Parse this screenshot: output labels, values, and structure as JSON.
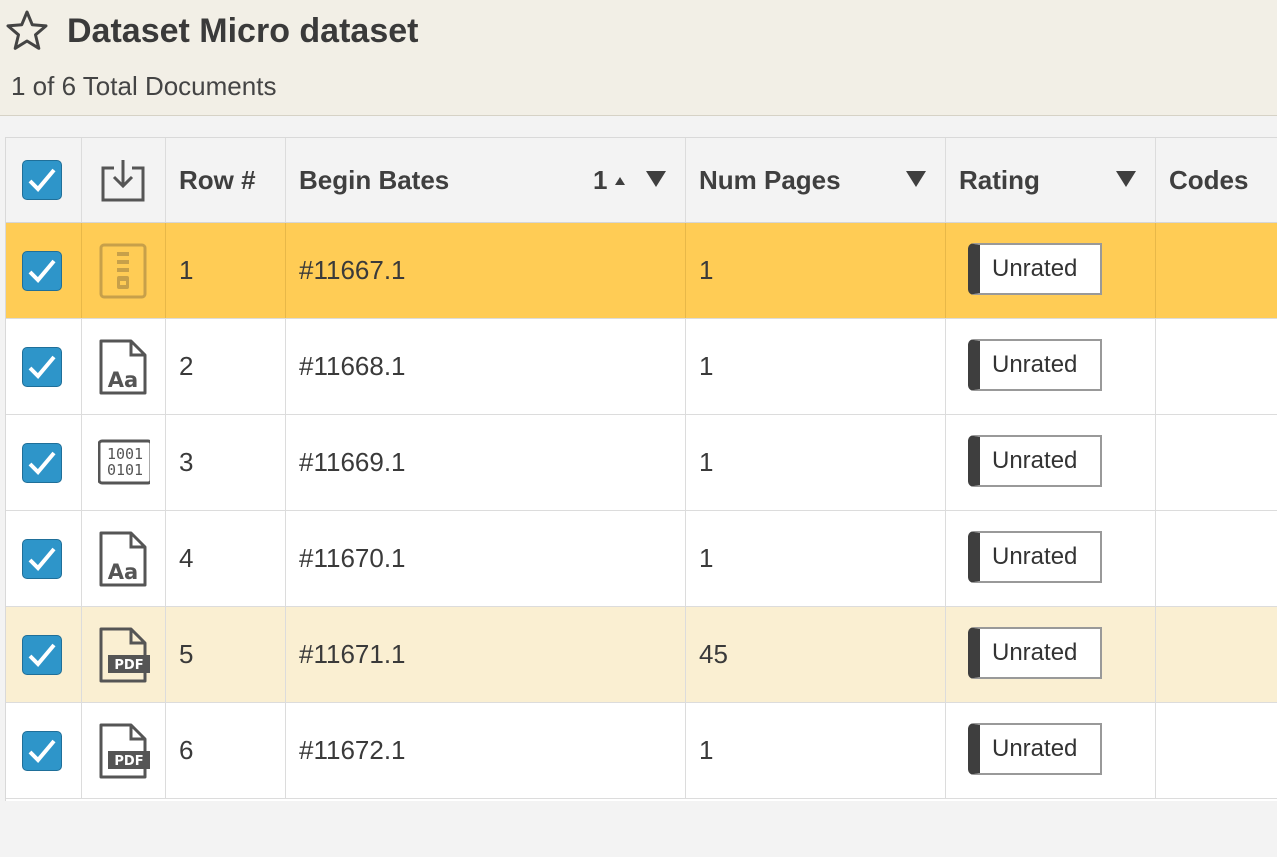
{
  "header": {
    "title": "Dataset Micro dataset",
    "subtitle": "1 of 6 Total Documents"
  },
  "columns": {
    "row_num": "Row #",
    "begin_bates": "Begin Bates",
    "begin_bates_sort": "1",
    "num_pages": "Num Pages",
    "rating": "Rating",
    "codes": "Codes"
  },
  "rows": [
    {
      "row": "1",
      "bates": "#11667.1",
      "pages": "1",
      "rating": "Unrated",
      "icon": "archive-file-icon"
    },
    {
      "row": "2",
      "bates": "#11668.1",
      "pages": "1",
      "rating": "Unrated",
      "icon": "text-document-icon"
    },
    {
      "row": "3",
      "bates": "#11669.1",
      "pages": "1",
      "rating": "Unrated",
      "icon": "binary-file-icon"
    },
    {
      "row": "4",
      "bates": "#11670.1",
      "pages": "1",
      "rating": "Unrated",
      "icon": "text-document-icon"
    },
    {
      "row": "5",
      "bates": "#11671.1",
      "pages": "45",
      "rating": "Unrated",
      "icon": "pdf-file-icon"
    },
    {
      "row": "6",
      "bates": "#11672.1",
      "pages": "1",
      "rating": "Unrated",
      "icon": "pdf-file-icon"
    }
  ],
  "colors": {
    "selected_row": "#ffcc55",
    "highlight_row": "#faefd2",
    "checkbox": "#2e95c9",
    "header_bg": "#f2efe6"
  }
}
